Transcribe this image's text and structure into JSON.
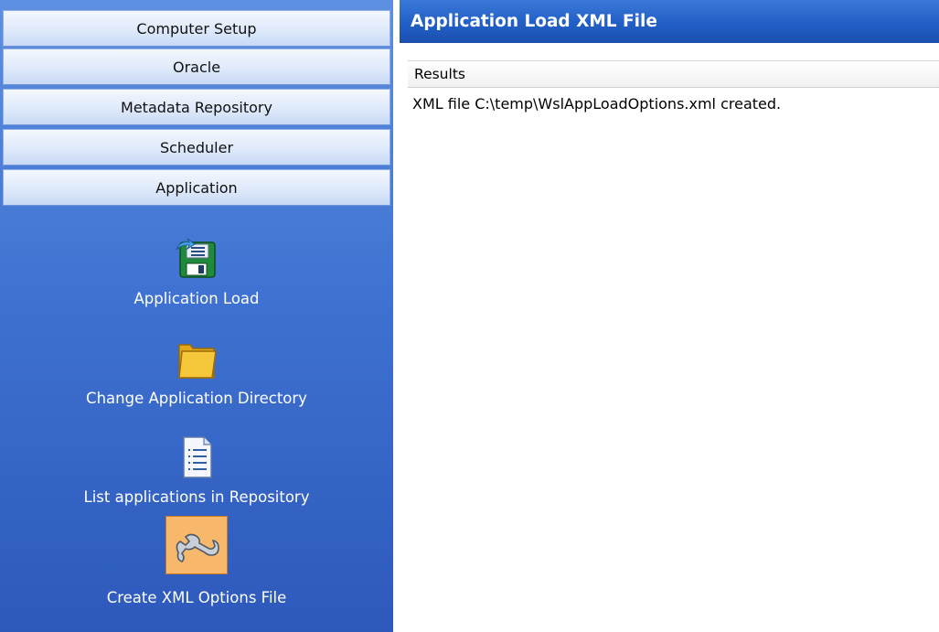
{
  "sidebar": {
    "sections": [
      {
        "label": "Computer Setup"
      },
      {
        "label": "Oracle"
      },
      {
        "label": "Metadata Repository"
      },
      {
        "label": "Scheduler"
      },
      {
        "label": "Application"
      }
    ],
    "items": [
      {
        "label": "Application Load",
        "icon": "application-load-icon"
      },
      {
        "label": "Change Application Directory",
        "icon": "folder-icon"
      },
      {
        "label": "List applications in Repository",
        "icon": "document-list-icon"
      },
      {
        "label": "Create XML Options File",
        "icon": "wrench-icon",
        "selected": true
      }
    ]
  },
  "main": {
    "title": "Application Load XML File",
    "results": {
      "header": "Results",
      "lines": [
        "XML file C:\\temp\\WslAppLoadOptions.xml created."
      ]
    }
  },
  "colors": {
    "title_bar": "#215fc6",
    "sidebar": "#3f72d2",
    "selected_item": "#f7b86b"
  }
}
